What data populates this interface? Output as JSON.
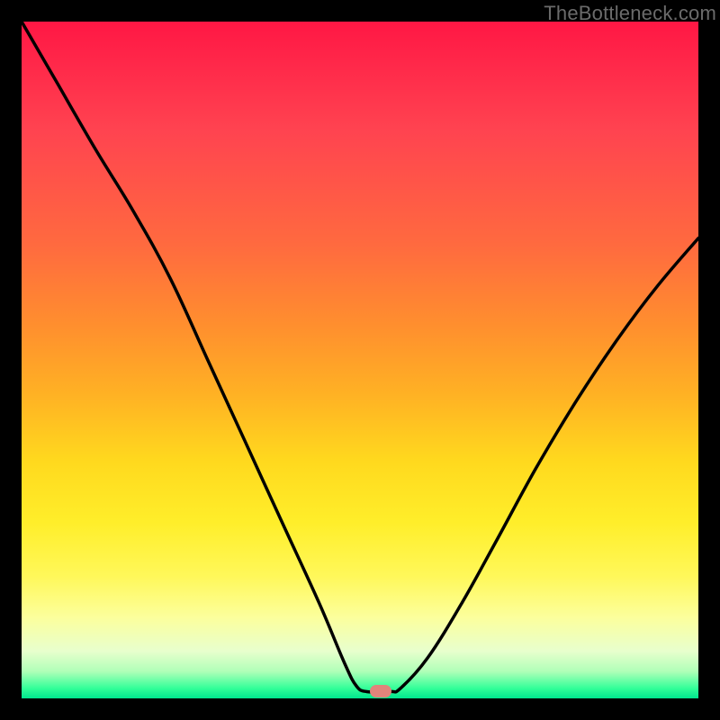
{
  "watermark": "TheBottleneck.com",
  "marker": {
    "cx_frac": 0.53,
    "cy_frac": 0.989
  },
  "chart_data": {
    "type": "line",
    "title": "",
    "xlabel": "",
    "ylabel": "",
    "xlim": [
      0,
      1
    ],
    "ylim": [
      0,
      1
    ],
    "series": [
      {
        "name": "bottleneck-curve",
        "x": [
          0.0,
          0.055,
          0.11,
          0.165,
          0.22,
          0.275,
          0.33,
          0.385,
          0.44,
          0.478,
          0.495,
          0.51,
          0.545,
          0.56,
          0.6,
          0.65,
          0.7,
          0.76,
          0.82,
          0.88,
          0.94,
          1.0
        ],
        "y": [
          1.0,
          0.905,
          0.81,
          0.72,
          0.62,
          0.5,
          0.38,
          0.26,
          0.14,
          0.05,
          0.018,
          0.01,
          0.01,
          0.015,
          0.06,
          0.14,
          0.23,
          0.34,
          0.44,
          0.53,
          0.61,
          0.68
        ]
      }
    ],
    "marker_point_frac": {
      "x": 0.53,
      "y": 0.011
    },
    "colors": {
      "top": "#ff1744",
      "mid": "#ffee2a",
      "bottom": "#00e68e",
      "curve": "#000000",
      "marker": "#e1847b"
    }
  }
}
